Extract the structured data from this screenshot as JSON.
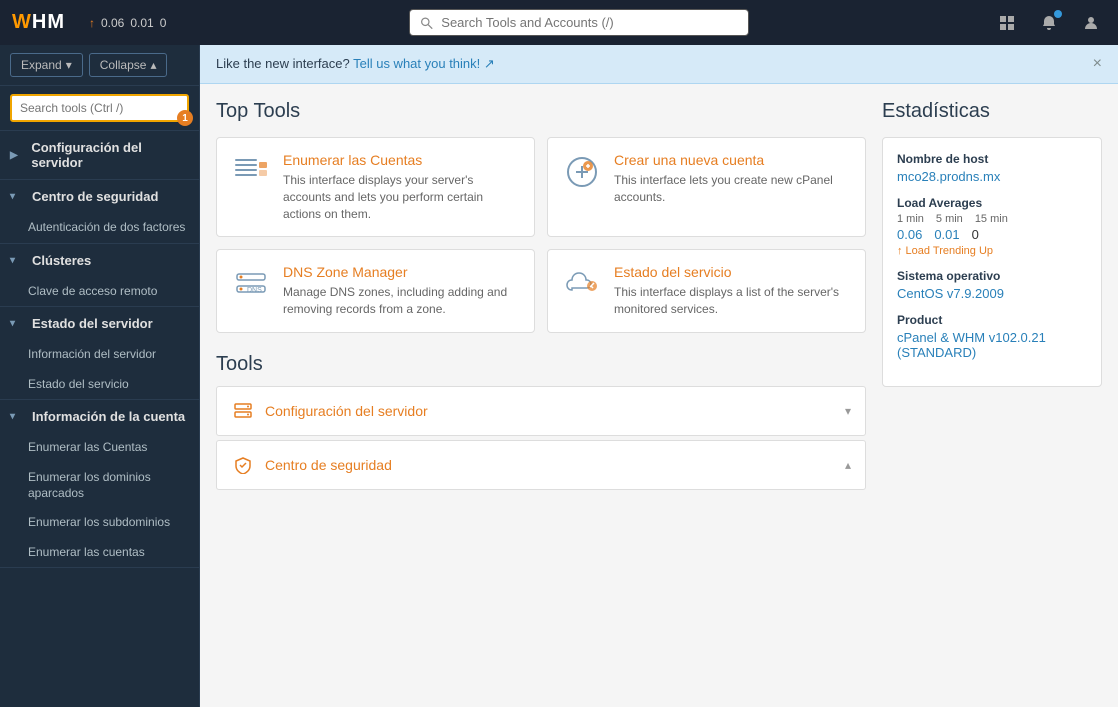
{
  "topbar": {
    "logo": "WHM",
    "stats": {
      "arrow": "↑",
      "val1": "0.06",
      "val2": "0.01",
      "val3": "0"
    },
    "search_placeholder": "Search Tools and Accounts (/)",
    "icons": {
      "grid": "⊞",
      "bell": "🔔",
      "user": "👤"
    }
  },
  "sidebar": {
    "expand_label": "Expand",
    "collapse_label": "Collapse",
    "search_placeholder": "Search tools (Ctrl /)",
    "badge": "1",
    "sections": [
      {
        "id": "configuracion",
        "label": "Configuración del servidor",
        "expanded": false,
        "items": []
      },
      {
        "id": "seguridad",
        "label": "Centro de seguridad",
        "expanded": true,
        "items": [
          "Autenticación de dos factores"
        ]
      },
      {
        "id": "clusteres",
        "label": "Clústeres",
        "expanded": true,
        "items": [
          "Clave de acceso remoto"
        ]
      },
      {
        "id": "estado-servidor",
        "label": "Estado del servidor",
        "expanded": true,
        "items": [
          "Información del servidor",
          "Estado del servicio"
        ]
      },
      {
        "id": "info-cuenta",
        "label": "Información de la cuenta",
        "expanded": true,
        "items": [
          "Enumerar las Cuentas",
          "Enumerar los dominios aparcados",
          "Enumerar los subdominios",
          "Enumerar las cuentas"
        ]
      }
    ]
  },
  "notice": {
    "text": "Like the new interface?",
    "link_text": "Tell us what you think!",
    "close": "×"
  },
  "top_tools": {
    "title": "Top Tools",
    "cards": [
      {
        "id": "enumerar-cuentas",
        "title": "Enumerar las Cuentas",
        "desc": "This interface displays your server's accounts and lets you perform certain actions on them.",
        "icon": "list"
      },
      {
        "id": "crear-cuenta",
        "title": "Crear una nueva cuenta",
        "desc": "This interface lets you create new cPanel accounts.",
        "icon": "plus-circle"
      },
      {
        "id": "dns-zone",
        "title": "DNS Zone Manager",
        "desc": "Manage DNS zones, including adding and removing records from a zone.",
        "icon": "dns"
      },
      {
        "id": "estado-servicio",
        "title": "Estado del servicio",
        "desc": "This interface displays a list of the server's monitored services.",
        "icon": "cloud"
      }
    ]
  },
  "tools": {
    "title": "Tools",
    "sections": [
      {
        "id": "config-servidor",
        "title": "Configuración del servidor",
        "icon": "server",
        "expanded": false
      },
      {
        "id": "centro-seguridad",
        "title": "Centro de seguridad",
        "icon": "shield",
        "expanded": true
      }
    ]
  },
  "stats": {
    "title": "Estadísticas",
    "hostname_label": "Nombre de host",
    "hostname_value": "mco28.prodns.mx",
    "load_label": "Load Averages",
    "load_headers": [
      "1 min",
      "5 min",
      "15 min"
    ],
    "load_values": [
      "0.06",
      "0.01",
      "0"
    ],
    "trending": "↑ Load Trending Up",
    "os_label": "Sistema operativo",
    "os_value": "CentOS v7.9.2009",
    "product_label": "Product",
    "product_value": "cPanel & WHM v102.0.21 (STANDARD)"
  }
}
